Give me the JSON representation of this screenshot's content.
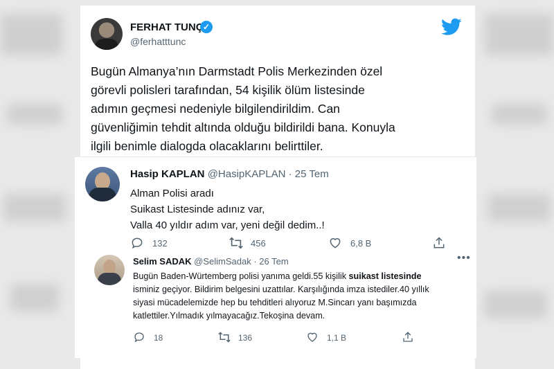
{
  "main_tweet": {
    "name": "FERHAT TUNÇ",
    "handle": "@ferhatttunc",
    "text_lines": [
      "Bugün Almanya’nın Darmstadt Polis Merkezinden özel",
      "görevli polisleri tarafından, 54 kişilik ölüm listesinde",
      "adımın geçmesi nedeniyle bilgilendirildim. Can",
      "güvenliğimin tehdit altında olduğu bildirildi bana. Konuyla",
      "ilgili benimle dialogda olacaklarını belirttiler."
    ]
  },
  "quote_1": {
    "name": "Hasip KAPLAN",
    "handle": "@HasipKAPLAN",
    "date": "· 25 Tem",
    "lines": [
      "Alman Polisi aradı",
      "Suikast Listesinde adınız var,",
      "Valla 40 yıldır adım var, yeni değil dedim..!"
    ],
    "actions": {
      "replies": "132",
      "retweets": "456",
      "likes": "6,8 B"
    }
  },
  "quote_2": {
    "name": "Selim SADAK",
    "handle": "@SelimSadak",
    "date": "· 26 Tem",
    "more": "•••",
    "line1_pre": "Bugün Baden-Würtemberg polisi yanıma geldi.55 kişilik ",
    "line1_bold": "suikast listesinde",
    "lines_rest": [
      "isminiz geçiyor. Bildirim belgesini uzattılar. Karşılığında imza istediler.40 yıllık",
      "siyasi mücadelemizde hep bu tehditleri alıyoruz M.Sincarı yanı başımızda",
      "katlettiler.Yılmadık yılmayacağız.Tekoşina devam."
    ],
    "actions": {
      "replies": "18",
      "retweets": "136",
      "likes": "1,1 B"
    }
  },
  "colors": {
    "twitter_blue": "#1d9bf0",
    "text": "#0f1419",
    "muted": "#536471"
  },
  "icons": [
    "twitter-bird-icon",
    "verified-badge-icon",
    "reply-icon",
    "retweet-icon",
    "like-icon",
    "share-icon",
    "more-icon"
  ]
}
